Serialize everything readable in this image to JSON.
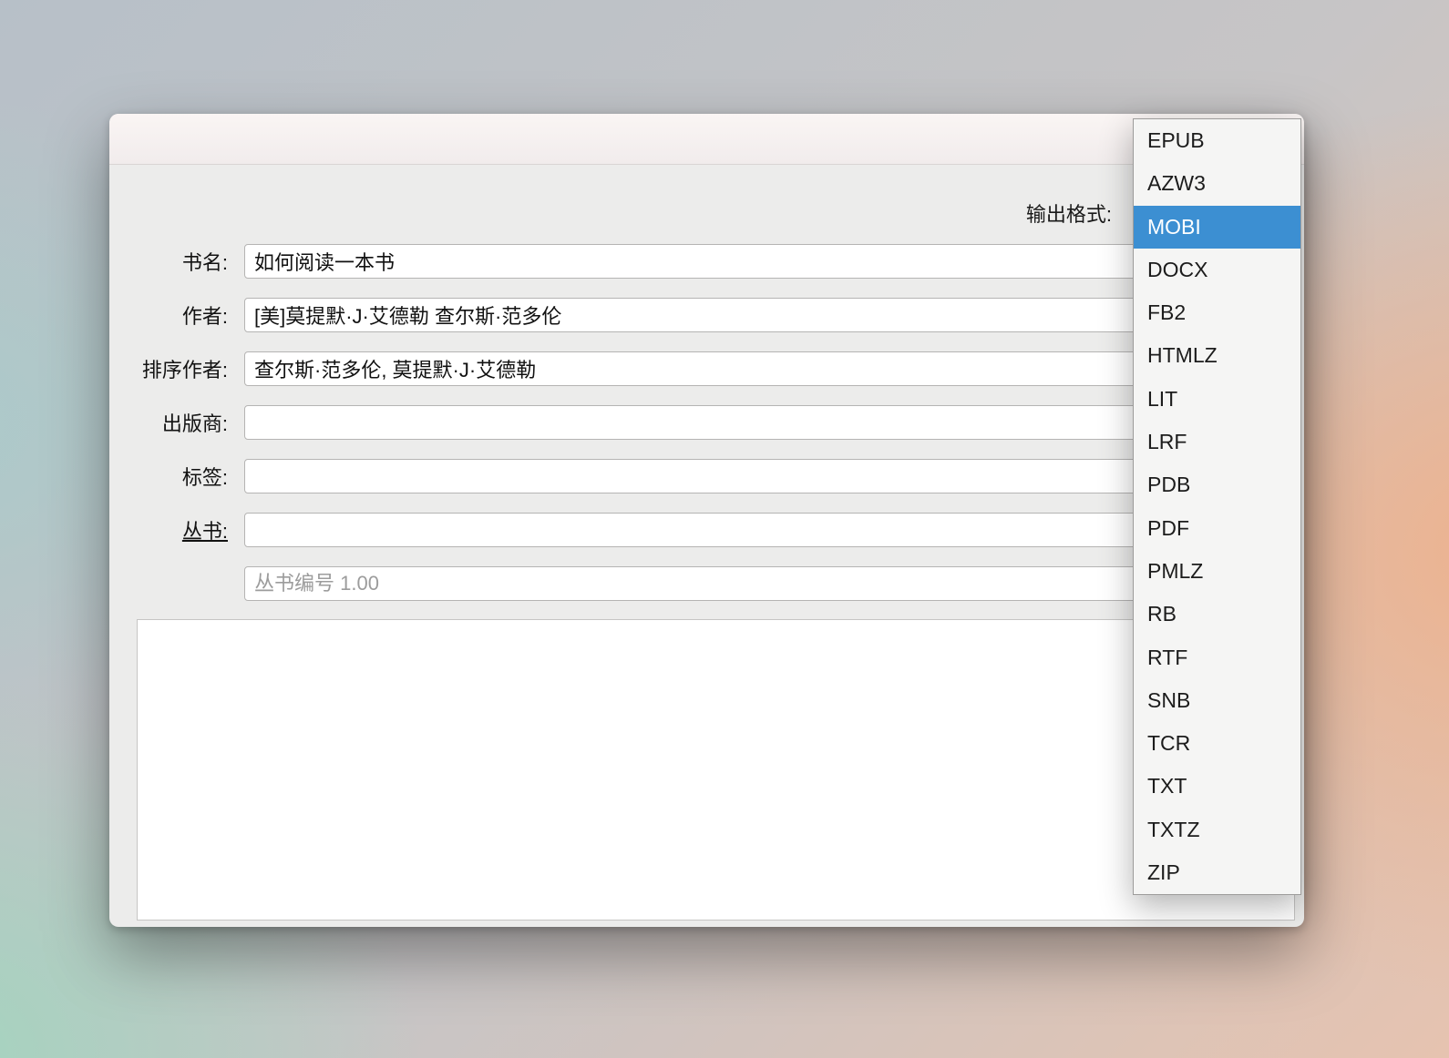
{
  "dialog": {
    "output_format_label": "输出格式:",
    "fields": [
      {
        "label": "书名:",
        "value": "如何阅读一本书"
      },
      {
        "label": "作者:",
        "value": "[美]莫提默·J·艾德勒 查尔斯·范多伦"
      },
      {
        "label": "排序作者:",
        "value": "查尔斯·范多伦, 莫提默·J·艾德勒"
      },
      {
        "label": "出版商:",
        "value": ""
      },
      {
        "label": "标签:",
        "value": ""
      },
      {
        "label": "丛书:",
        "value": ""
      }
    ],
    "series_index": {
      "placeholder": "丛书编号 1.00"
    },
    "comments": {
      "value": ""
    }
  },
  "dropdown": {
    "selected": "MOBI",
    "highlight_color": "#3c8fd2",
    "items": [
      "EPUB",
      "AZW3",
      "MOBI",
      "DOCX",
      "FB2",
      "HTMLZ",
      "LIT",
      "LRF",
      "PDB",
      "PDF",
      "PMLZ",
      "RB",
      "RTF",
      "SNB",
      "TCR",
      "TXT",
      "TXTZ",
      "ZIP"
    ]
  }
}
